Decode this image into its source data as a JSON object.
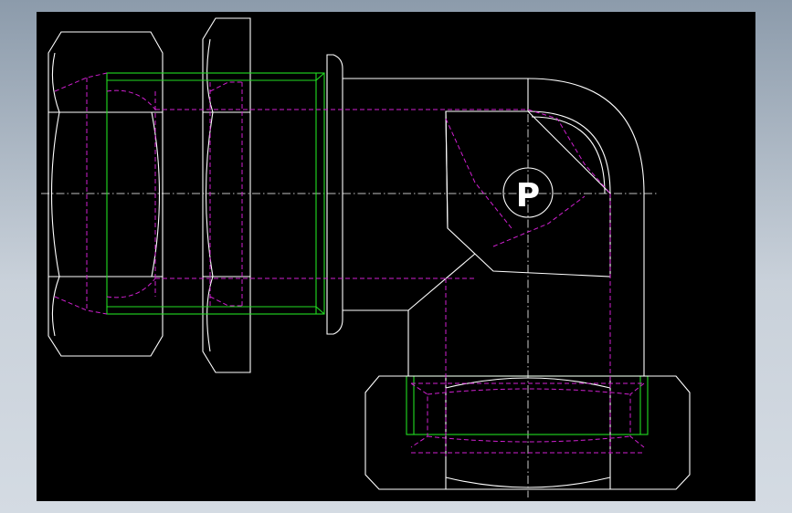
{
  "drawing": {
    "description_label": "",
    "colors": {
      "background": "#000000",
      "outline": "#ffffff",
      "thread": "#22dd22",
      "hidden": "#d020d0",
      "frame": "#8c9bab"
    },
    "logo_letter": "P"
  }
}
